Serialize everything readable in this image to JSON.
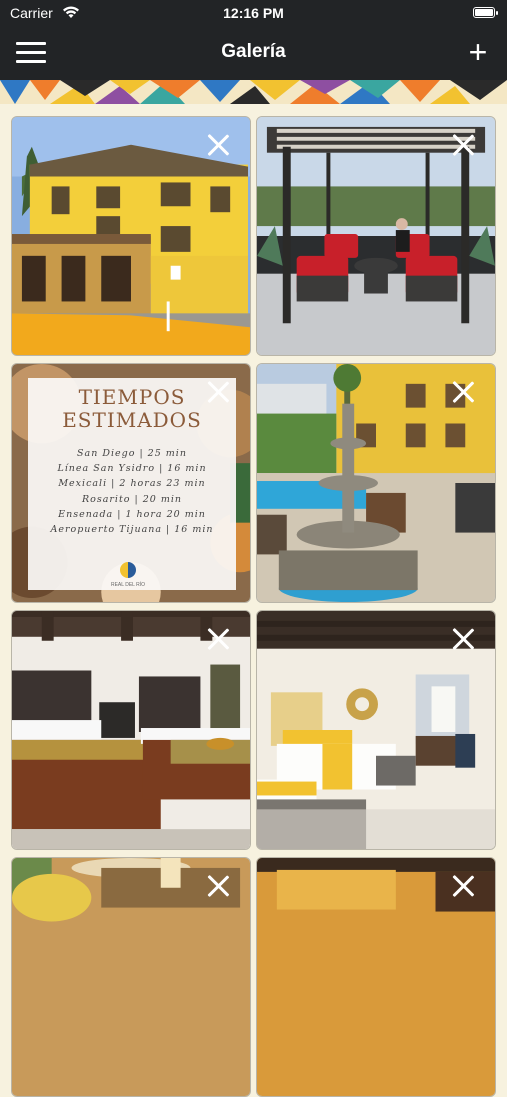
{
  "status_bar": {
    "carrier": "Carrier",
    "time": "12:16 PM"
  },
  "nav": {
    "title": "Galería"
  },
  "colors": {
    "nav_bg": "#222426",
    "page_bg": "#f7f2df",
    "accent_yellow": "#f2c230"
  },
  "gallery": [
    {
      "name": "hotel-exterior-yellow-building",
      "close_icon": "close-icon"
    },
    {
      "name": "patio-pergola-seating",
      "close_icon": "close-icon"
    },
    {
      "name": "tiempos-estimados-poster",
      "close_icon": "close-icon"
    },
    {
      "name": "pool-fountain-courtyard",
      "close_icon": "close-icon"
    },
    {
      "name": "hotel-room-two-beds-brown",
      "close_icon": "close-icon"
    },
    {
      "name": "hotel-room-yellow-accent",
      "close_icon": "close-icon"
    },
    {
      "name": "restaurant-terrace-umbrellas",
      "close_icon": "close-icon"
    },
    {
      "name": "interior-warm-lighting",
      "close_icon": "close-icon"
    }
  ],
  "poster": {
    "title": "TIEMPOS\nESTIMADOS",
    "lines": [
      "San Diego | 25 min",
      "Línea San Ysidro | 16 min",
      "Mexicali | 2 horas 23 min",
      "Rosarito | 20 min",
      "Ensenada | 1 hora 20 min",
      "Aeropuerto Tijuana | 16 min"
    ],
    "logo_text": "REAL DEL RÍO"
  }
}
